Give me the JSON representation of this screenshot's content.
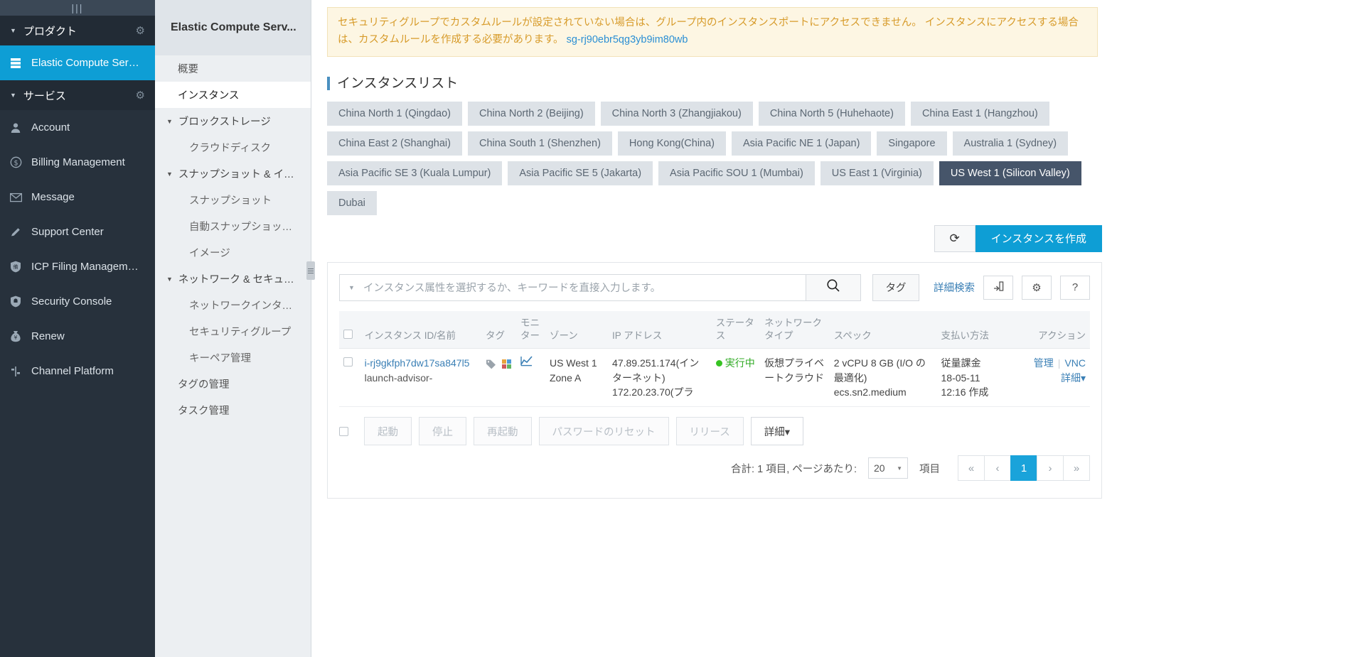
{
  "nav1": {
    "hamburger": "|||",
    "groups": [
      {
        "label": "プロダクト",
        "gear": "⚙"
      },
      {
        "label": "サービス",
        "gear": "⚙"
      }
    ],
    "product_item": {
      "label": "Elastic Compute Ser…",
      "icon": "server-icon"
    },
    "service_items": [
      {
        "label": "Account",
        "icon": "user-icon",
        "glyph": "P"
      },
      {
        "label": "Billing Management",
        "icon": "dollar-icon",
        "glyph": "$"
      },
      {
        "label": "Message",
        "icon": "envelope-icon",
        "glyph": "✉"
      },
      {
        "label": "Support Center",
        "icon": "pencil-icon",
        "glyph": "✎"
      },
      {
        "label": "ICP Filing Managem…",
        "icon": "shield-filing-icon",
        "glyph": "備"
      },
      {
        "label": "Security Console",
        "icon": "shield-icon",
        "glyph": "⛊"
      },
      {
        "label": "Renew",
        "icon": "money-bag-icon",
        "glyph": "¥"
      },
      {
        "label": "Channel Platform",
        "icon": "channel-icon",
        "glyph": "⌁"
      }
    ]
  },
  "nav2": {
    "title": "Elastic Compute Serv...",
    "links": [
      {
        "label": "概要",
        "selected": false
      },
      {
        "label": "インスタンス",
        "selected": true
      }
    ],
    "sections": [
      {
        "label": "ブロックストレージ",
        "children": [
          "クラウドディスク"
        ]
      },
      {
        "label": "スナップショット & イ…",
        "children": [
          "スナップショット",
          "自動スナップショッ…",
          "イメージ"
        ]
      },
      {
        "label": "ネットワーク & セキュ…",
        "children": [
          "ネットワークインタ…",
          "セキュリティグループ",
          "キーペア管理"
        ]
      }
    ],
    "tail_links": [
      "タグの管理",
      "タスク管理"
    ]
  },
  "warning": {
    "text": "セキュリティグループでカスタムルールが設定されていない場合は、グループ内のインスタンスポートにアクセスできません。 インスタンスにアクセスする場合は、カスタムルールを作成する必要があります。",
    "link": "sg-rj90ebr5qg3yb9im80wb"
  },
  "page": {
    "title": "インスタンスリスト"
  },
  "regions": [
    {
      "label": "China North 1 (Qingdao)",
      "active": false
    },
    {
      "label": "China North 2 (Beijing)",
      "active": false
    },
    {
      "label": "China North 3 (Zhangjiakou)",
      "active": false
    },
    {
      "label": "China North 5 (Huhehaote)",
      "active": false
    },
    {
      "label": "China East 1 (Hangzhou)",
      "active": false
    },
    {
      "label": "China East 2 (Shanghai)",
      "active": false
    },
    {
      "label": "China South 1 (Shenzhen)",
      "active": false
    },
    {
      "label": "Hong Kong(China)",
      "active": false
    },
    {
      "label": "Asia Pacific NE 1 (Japan)",
      "active": false
    },
    {
      "label": "Singapore",
      "active": false
    },
    {
      "label": "Australia 1 (Sydney)",
      "active": false
    },
    {
      "label": "Asia Pacific SE 3 (Kuala Lumpur)",
      "active": false
    },
    {
      "label": "Asia Pacific SE 5 (Jakarta)",
      "active": false
    },
    {
      "label": "Asia Pacific SOU 1 (Mumbai)",
      "active": false
    },
    {
      "label": "US East 1 (Virginia)",
      "active": false
    },
    {
      "label": "US West 1 (Silicon Valley)",
      "active": true
    },
    {
      "label": "Dubai",
      "active": false
    }
  ],
  "toolbar": {
    "refresh_icon": "refresh-icon",
    "refresh_glyph": "⟳",
    "create_label": "インスタンスを作成"
  },
  "search": {
    "placeholder": "インスタンス属性を選択するか、キーワードを直接入力します。",
    "search_icon": "search-icon",
    "tag_label": "タグ",
    "advanced_label": "詳細検索",
    "export_icon": "export-icon",
    "export_glyph": "⇥",
    "settings_icon": "gear-icon",
    "settings_glyph": "⚙",
    "help_icon": "help-icon",
    "help_glyph": "?"
  },
  "table": {
    "headers": [
      "インスタンス ID/名前",
      "タグ",
      "モニター",
      "ゾーン",
      "IP アドレス",
      "ステータス",
      "ネットワークタイプ",
      "スペック",
      "支払い方法",
      "アクション"
    ],
    "rows": [
      {
        "id": "i-rj9gkfph7dw17sa847l5",
        "name": "launch-advisor-",
        "tag_icon": "tag-icon",
        "monitor_icon": "chart-icon",
        "zone": "US West 1 Zone A",
        "ip_public": "47.89.251.174(インターネット)",
        "ip_private": "172.20.23.70(プラ",
        "status": "実行中",
        "status_color": "#36c322",
        "network_type": "仮想プライベートクラウド",
        "spec_line1": "2 vCPU 8 GB (I/O の最適化)",
        "spec_line2": "ecs.sn2.medium",
        "payment_line1": "従量課金",
        "payment_line2": "18-05-11",
        "payment_line3": "12:16 作成",
        "action_manage": "管理",
        "action_vnc": "VNC",
        "action_detail": "詳細▾"
      }
    ]
  },
  "bulk": {
    "buttons": [
      {
        "label": "起動",
        "enabled": false
      },
      {
        "label": "停止",
        "enabled": false
      },
      {
        "label": "再起動",
        "enabled": false
      },
      {
        "label": "パスワードのリセット",
        "enabled": false
      },
      {
        "label": "リリース",
        "enabled": false
      },
      {
        "label": "詳細▾",
        "enabled": true
      }
    ]
  },
  "pagination": {
    "summary_prefix": "合計: 1 項目, ページあたり:",
    "page_size": "20",
    "summary_suffix": "項目",
    "first": "«",
    "prev": "‹",
    "current": "1",
    "next": "›",
    "last": "»"
  }
}
